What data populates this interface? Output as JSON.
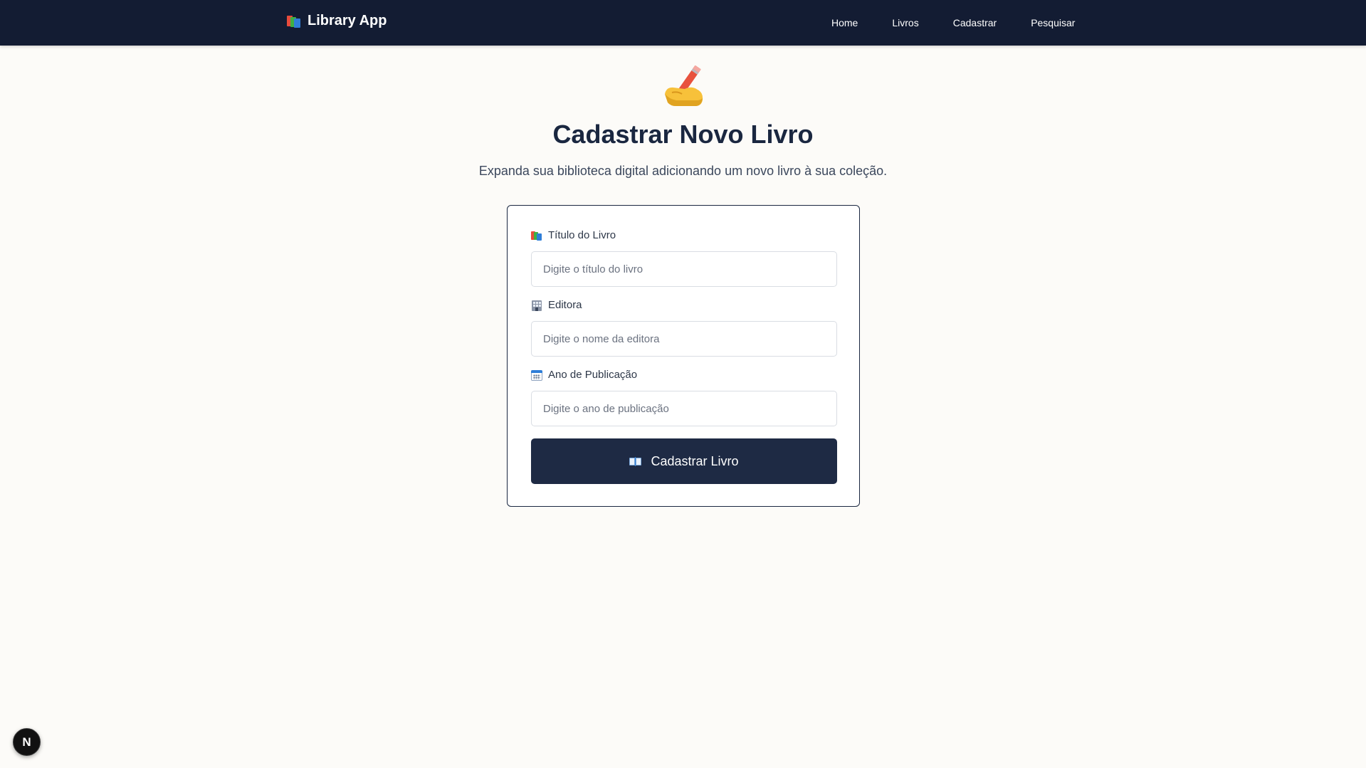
{
  "navbar": {
    "brand": "Library App",
    "brand_icon": "books-icon",
    "links": [
      "Home",
      "Livros",
      "Cadastrar",
      "Pesquisar"
    ]
  },
  "hero": {
    "icon": "writing-hand-icon",
    "title": "Cadastrar Novo Livro",
    "subtitle": "Expanda sua biblioteca digital adicionando um novo livro à sua coleção."
  },
  "form": {
    "fields": [
      {
        "label": "Título do Livro",
        "icon": "books-icon",
        "placeholder": "Digite o título do livro",
        "value": ""
      },
      {
        "label": "Editora",
        "icon": "office-building-icon",
        "placeholder": "Digite o nome da editora",
        "value": ""
      },
      {
        "label": "Ano de Publicação",
        "icon": "calendar-icon",
        "placeholder": "Digite o ano de publicação",
        "value": ""
      }
    ],
    "submit": {
      "label": "Cadastrar Livro",
      "icon": "open-book-icon"
    }
  },
  "dev_badge": {
    "label": "N",
    "icon": "nextjs-icon"
  },
  "colors": {
    "navbar_bg": "#131c33",
    "page_bg": "#fcfbf8",
    "title": "#1a2740",
    "button_bg": "#1e2a44",
    "card_border": "#1a2740"
  }
}
